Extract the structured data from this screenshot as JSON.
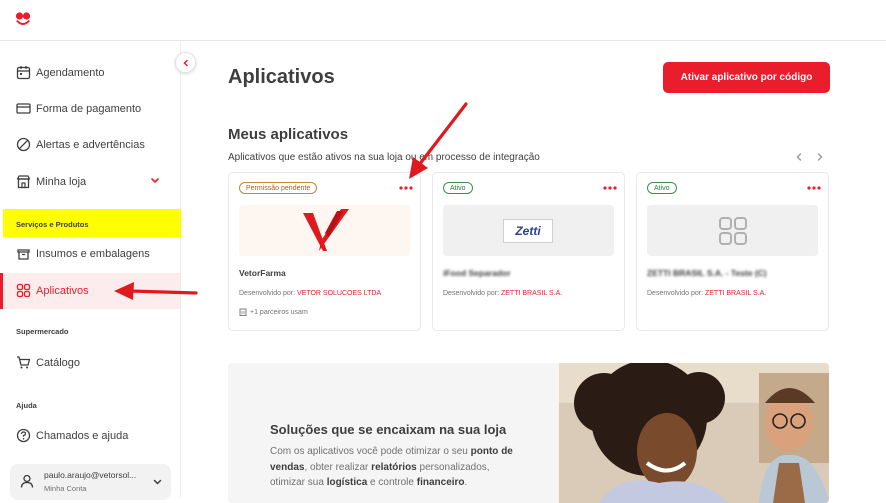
{
  "sidebar": {
    "items": [
      {
        "label": "Agendamento"
      },
      {
        "label": "Forma de pagamento"
      },
      {
        "label": "Alertas e advertências"
      },
      {
        "label": "Minha loja"
      },
      {
        "label": "Insumos e embalagens"
      },
      {
        "label": "Aplicativos"
      },
      {
        "label": "Catálogo"
      },
      {
        "label": "Chamados e ajuda"
      }
    ],
    "sections": {
      "services": "Serviços e Produtos",
      "supermarket": "Supermercado",
      "help": "Ajuda"
    },
    "user": {
      "name": "paulo.araujo@vetorsol...",
      "sub": "Minha Conta"
    }
  },
  "main": {
    "title": "Aplicativos",
    "activate_button": "Ativar aplicativo por código",
    "my_apps_title": "Meus aplicativos",
    "my_apps_subtitle": "Aplicativos que estão ativos na sua loja ou em processo de integração",
    "apps": [
      {
        "status": "Permissão pendente",
        "name": "VetorFarma",
        "dev_label": "Desenvolvido por:",
        "developer": "VETOR SOLUCOES LTDA",
        "partners": "+1 parceiros usam"
      },
      {
        "status": "Ativo",
        "name": "iFood Separador",
        "dev_label": "Desenvolvido por:",
        "developer": "ZETTI BRASIL S.A.",
        "thumb_text": "Zetti"
      },
      {
        "status": "Ativo",
        "name": "ZETTI BRASIL S.A. - Teste (C)",
        "dev_label": "Desenvolvido por:",
        "developer": "ZETTI BRASIL S.A."
      }
    ],
    "promo": {
      "title": "Soluções que se encaixam na sua loja",
      "text_1": "Com os aplicativos você pode otimizar o seu ",
      "bold_1": "ponto de vendas",
      "text_2": ", obter realizar ",
      "bold_2": "relatórios",
      "text_3": " personalizados, otimizar sua ",
      "bold_3": "logística",
      "text_4": " e controle ",
      "bold_4": "financeiro",
      "text_5": "."
    }
  },
  "colors": {
    "brand_red": "#ea1d2c",
    "highlight_yellow": "#ffff00",
    "active_bg": "#fdecee",
    "annotation_arrow": "#e0191e"
  }
}
